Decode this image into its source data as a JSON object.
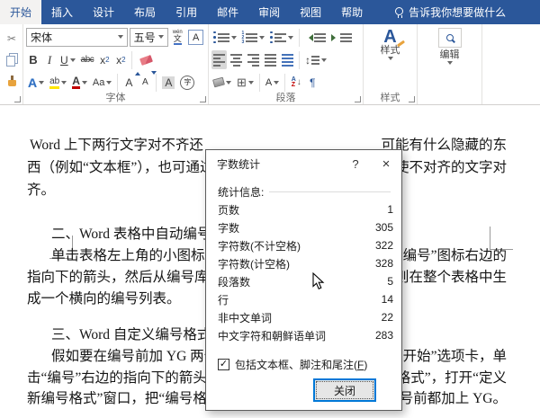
{
  "ribbon": {
    "tabs": [
      "开始",
      "插入",
      "设计",
      "布局",
      "引用",
      "邮件",
      "审阅",
      "视图",
      "帮助"
    ],
    "tell_me": "告诉我你想要做什么",
    "font_group": {
      "label": "字体",
      "font_name": "宋体",
      "font_size": "五号",
      "bold": "B",
      "italic": "I",
      "underline": "U",
      "strikethrough": "abc",
      "subscript_base": "x",
      "subscript_small": "2",
      "superscript_base": "x",
      "superscript_small": "2",
      "phonetic_top": "wén",
      "phonetic_bottom": "文",
      "char_border": "A",
      "text_effects": "A",
      "highlight": "ab",
      "font_color": "A",
      "change_case": "Aa",
      "grow_font": "A",
      "shrink_font": "A",
      "char_shading": "A",
      "enclose_char": "字"
    },
    "paragraph_group": {
      "label": "段落",
      "spacing_glyph": "↕",
      "sort_a": "A",
      "sort_z": "Z",
      "sort_arrow": "↓",
      "pilcrow": "¶",
      "border_glyph": "⊞",
      "asian_layout": "A"
    },
    "styles_group": {
      "label": "样式",
      "big_a": "A",
      "button": "样式"
    },
    "editing_group": {
      "button": "编辑"
    }
  },
  "document": {
    "lines": [
      {
        "left": "Word 上下两行文字对不齐还",
        "right": "可能有什么隐藏的东"
      },
      {
        "left": "西（例如“文本框”），也可通过双",
        "right": "能使不对齐的文字对"
      },
      {
        "left": "齐。",
        "right": ""
      },
      {
        "left": "二、Word 表格中自动编号，生",
        "right": ""
      },
      {
        "left": "单击表格左上角的小图标选中",
        "right": "“编号”图标右边的"
      },
      {
        "left": "指向下的箭头，然后从编号库中选",
        "right": "，则在整个表格中生"
      },
      {
        "left": "成一个横向的编号列表。",
        "right": ""
      },
      {
        "left": "三、Word 自定义编号格式",
        "right": ""
      },
      {
        "left": "假如要在编号前加 YG 两个字",
        "right": "“开始”选项卡，单"
      },
      {
        "left": "击“编号”右边的指向下的箭头，",
        "right": "格式”，打开“定义"
      },
      {
        "left": "新编号格式”窗口，把“编号格式",
        "right": "有编号前都加上 YG。"
      }
    ]
  },
  "dialog": {
    "title": "字数统计",
    "help_glyph": "?",
    "close_glyph": "×",
    "section_label": "统计信息:",
    "stats": [
      {
        "label": "页数",
        "value": "1"
      },
      {
        "label": "字数",
        "value": "305"
      },
      {
        "label": "字符数(不计空格)",
        "value": "322"
      },
      {
        "label": "字符数(计空格)",
        "value": "328"
      },
      {
        "label": "段落数",
        "value": "5"
      },
      {
        "label": "行",
        "value": "14"
      },
      {
        "label": "非中文单词",
        "value": "22"
      },
      {
        "label": "中文字符和朝鲜语单词",
        "value": "283"
      }
    ],
    "checkbox": {
      "checked_glyph": "✓",
      "label_pre": "包括文本框、脚注和尾注(",
      "mnemonic": "F",
      "label_post": ")"
    },
    "close_button": "关闭"
  },
  "colors": {
    "accent_blue": "#2b579a",
    "focus_blue": "#0078d7",
    "highlight_yellow": "#ffe600",
    "font_color_red": "#c00000"
  }
}
